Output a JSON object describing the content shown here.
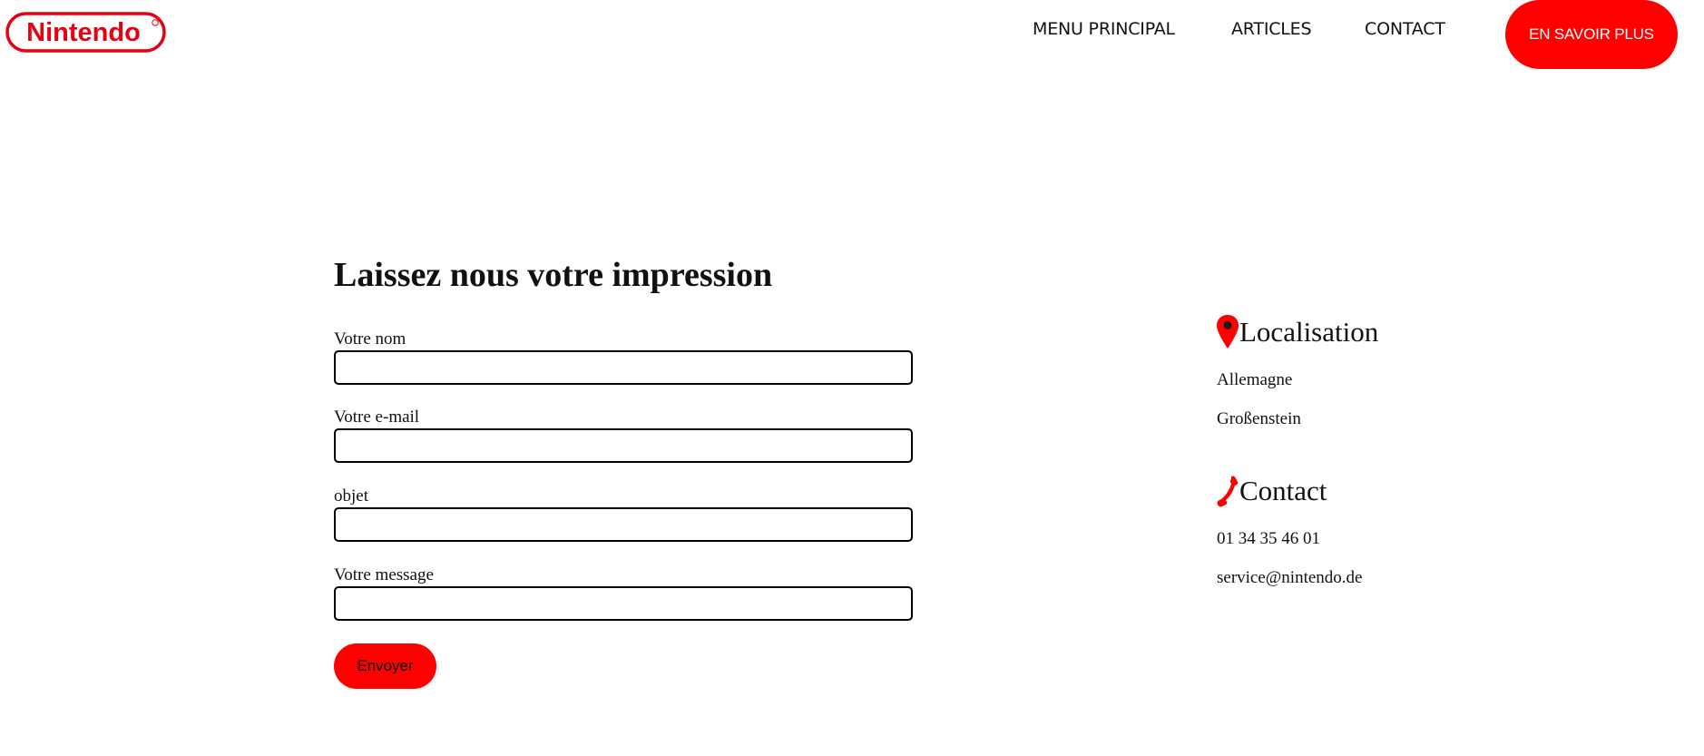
{
  "header": {
    "logo_text": "Nintendo",
    "nav": [
      {
        "label": "MENU PRINCIPAL"
      },
      {
        "label": "ARTICLES"
      },
      {
        "label": "CONTACT"
      }
    ],
    "cta_label": "EN SAVOIR PLUS"
  },
  "form": {
    "title": "Laissez nous votre impression",
    "fields": [
      {
        "label": "Votre nom",
        "value": "",
        "placeholder": ""
      },
      {
        "label": "Votre e-mail",
        "value": "",
        "placeholder": ""
      },
      {
        "label": "objet",
        "value": "",
        "placeholder": ""
      },
      {
        "label": "Votre message",
        "value": "",
        "placeholder": ""
      }
    ],
    "submit_label": "Envoyer"
  },
  "info": {
    "location": {
      "heading": "Localisation",
      "icon": "map-pin-icon",
      "lines": [
        "Allemagne",
        "Großenstein"
      ]
    },
    "contact": {
      "heading": "Contact",
      "icon": "phone-icon",
      "lines": [
        "01 34 35 46 01",
        "service@nintendo.de"
      ]
    }
  },
  "colors": {
    "brand_red": "#ff0000",
    "text": "#111111",
    "background": "#ffffff"
  }
}
